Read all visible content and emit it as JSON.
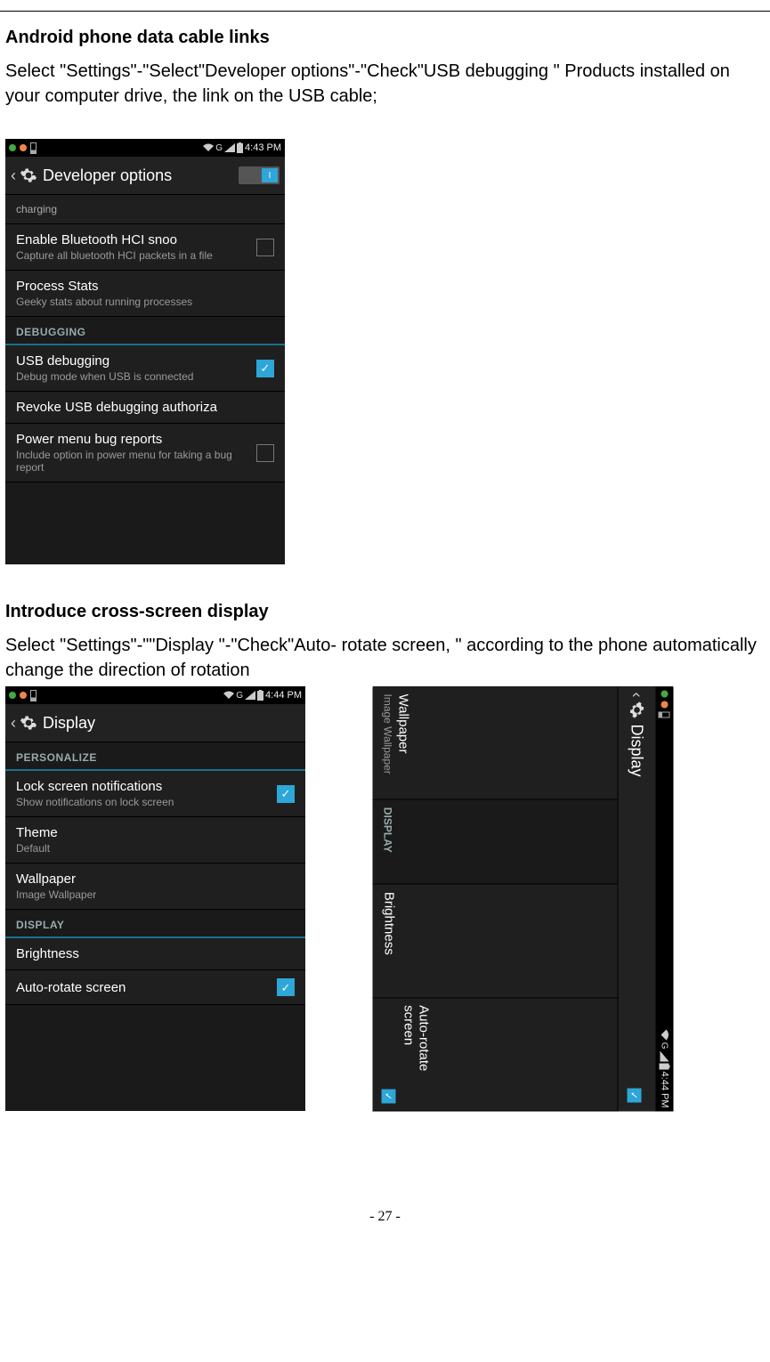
{
  "page_number": "- 27 -",
  "section1": {
    "heading": "Android phone data cable links",
    "body": "Select \"Settings\"-\"Select\"Developer options\"-\"Check\"USB debugging \" Products installed on your computer drive, the link on the USB cable;"
  },
  "section2": {
    "heading": "Introduce cross-screen display",
    "body": "Select \"Settings\"-\"\"Display \"-\"Check\"Auto- rotate screen, \" according to the phone automatically change the direction of rotation"
  },
  "shot1": {
    "status": {
      "time": "4:43 PM",
      "net": "G"
    },
    "title": "Developer options",
    "rows": [
      {
        "kind": "tiny",
        "title": "charging",
        "sub": "",
        "check": null
      },
      {
        "kind": "item",
        "title": "Enable Bluetooth HCI snoo",
        "sub": "Capture all bluetooth HCI packets in a file",
        "check": "off"
      },
      {
        "kind": "item",
        "title": "Process Stats",
        "sub": "Geeky stats about running processes",
        "check": null
      },
      {
        "kind": "hdr",
        "title": "DEBUGGING"
      },
      {
        "kind": "item",
        "title": "USB debugging",
        "sub": "Debug mode when USB is connected",
        "check": "on"
      },
      {
        "kind": "item",
        "title": "Revoke USB debugging authoriza",
        "sub": "",
        "check": null
      },
      {
        "kind": "item",
        "title": "Power menu bug reports",
        "sub": "Include option in power menu for taking a bug report",
        "check": "off"
      }
    ]
  },
  "shot2": {
    "status": {
      "time": "4:44 PM",
      "net": "G"
    },
    "title": "Display",
    "rows": [
      {
        "kind": "hdr",
        "title": "PERSONALIZE"
      },
      {
        "kind": "item",
        "title": "Lock screen notifications",
        "sub": "Show notifications on lock screen",
        "check": "on"
      },
      {
        "kind": "item",
        "title": "Theme",
        "sub": "Default",
        "check": null
      },
      {
        "kind": "item",
        "title": "Wallpaper",
        "sub": "Image Wallpaper",
        "check": null
      },
      {
        "kind": "hdr",
        "title": "DISPLAY"
      },
      {
        "kind": "item",
        "title": "Brightness",
        "sub": "",
        "check": null
      },
      {
        "kind": "item",
        "title": "Auto-rotate screen",
        "sub": "",
        "check": "on"
      }
    ]
  },
  "shot3": {
    "status": {
      "time": "4:44 PM",
      "net": "G"
    },
    "title": "Display",
    "cells": [
      {
        "kind": "item",
        "title": "Wallpaper",
        "sub": "Image Wallpaper"
      },
      {
        "kind": "hdr",
        "title": "DISPLAY"
      },
      {
        "kind": "item",
        "title": "Brightness",
        "sub": ""
      },
      {
        "kind": "item",
        "title": "Auto-rotate screen",
        "sub": "",
        "check": "on"
      }
    ]
  }
}
